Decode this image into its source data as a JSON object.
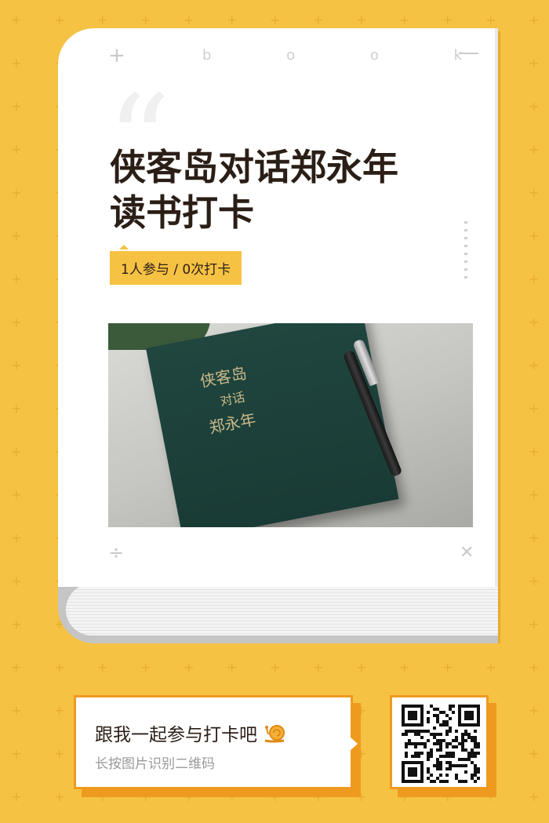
{
  "header": {
    "deco_word": "b o o k"
  },
  "title_lines": [
    "侠客岛对话郑永年",
    "读书打卡"
  ],
  "stats": "1人参与 / 0次打卡",
  "photo": {
    "book_cover_text": [
      "侠客岛",
      "对话",
      "郑永年"
    ]
  },
  "cta": {
    "title": "跟我一起参与打卡吧",
    "subtitle": "长按图片识别二维码",
    "icon": "snail-icon"
  },
  "colors": {
    "background": "#f6c244",
    "accent": "#ee9a1f",
    "title_text": "#2b1e16"
  }
}
